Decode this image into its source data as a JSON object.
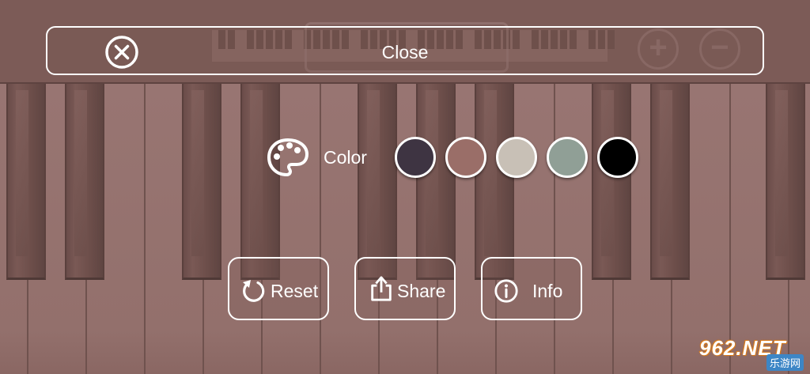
{
  "close_bar": {
    "label": "Close",
    "icon": "close-circle-icon"
  },
  "color_picker": {
    "label": "Color",
    "icon": "palette-icon",
    "swatches": [
      "#3e3442",
      "#9a6e68",
      "#c8c0b6",
      "#909f96",
      "#000000"
    ]
  },
  "actions": [
    {
      "label": "Reset",
      "icon": "reset-icon"
    },
    {
      "label": "Share",
      "icon": "share-icon"
    },
    {
      "label": "Info",
      "icon": "info-icon"
    }
  ],
  "background": {
    "zoom_in_icon": "zoom-in-icon",
    "zoom_out_icon": "zoom-out-icon"
  },
  "watermark": {
    "brand": "962.NET",
    "sub": "乐游网"
  }
}
